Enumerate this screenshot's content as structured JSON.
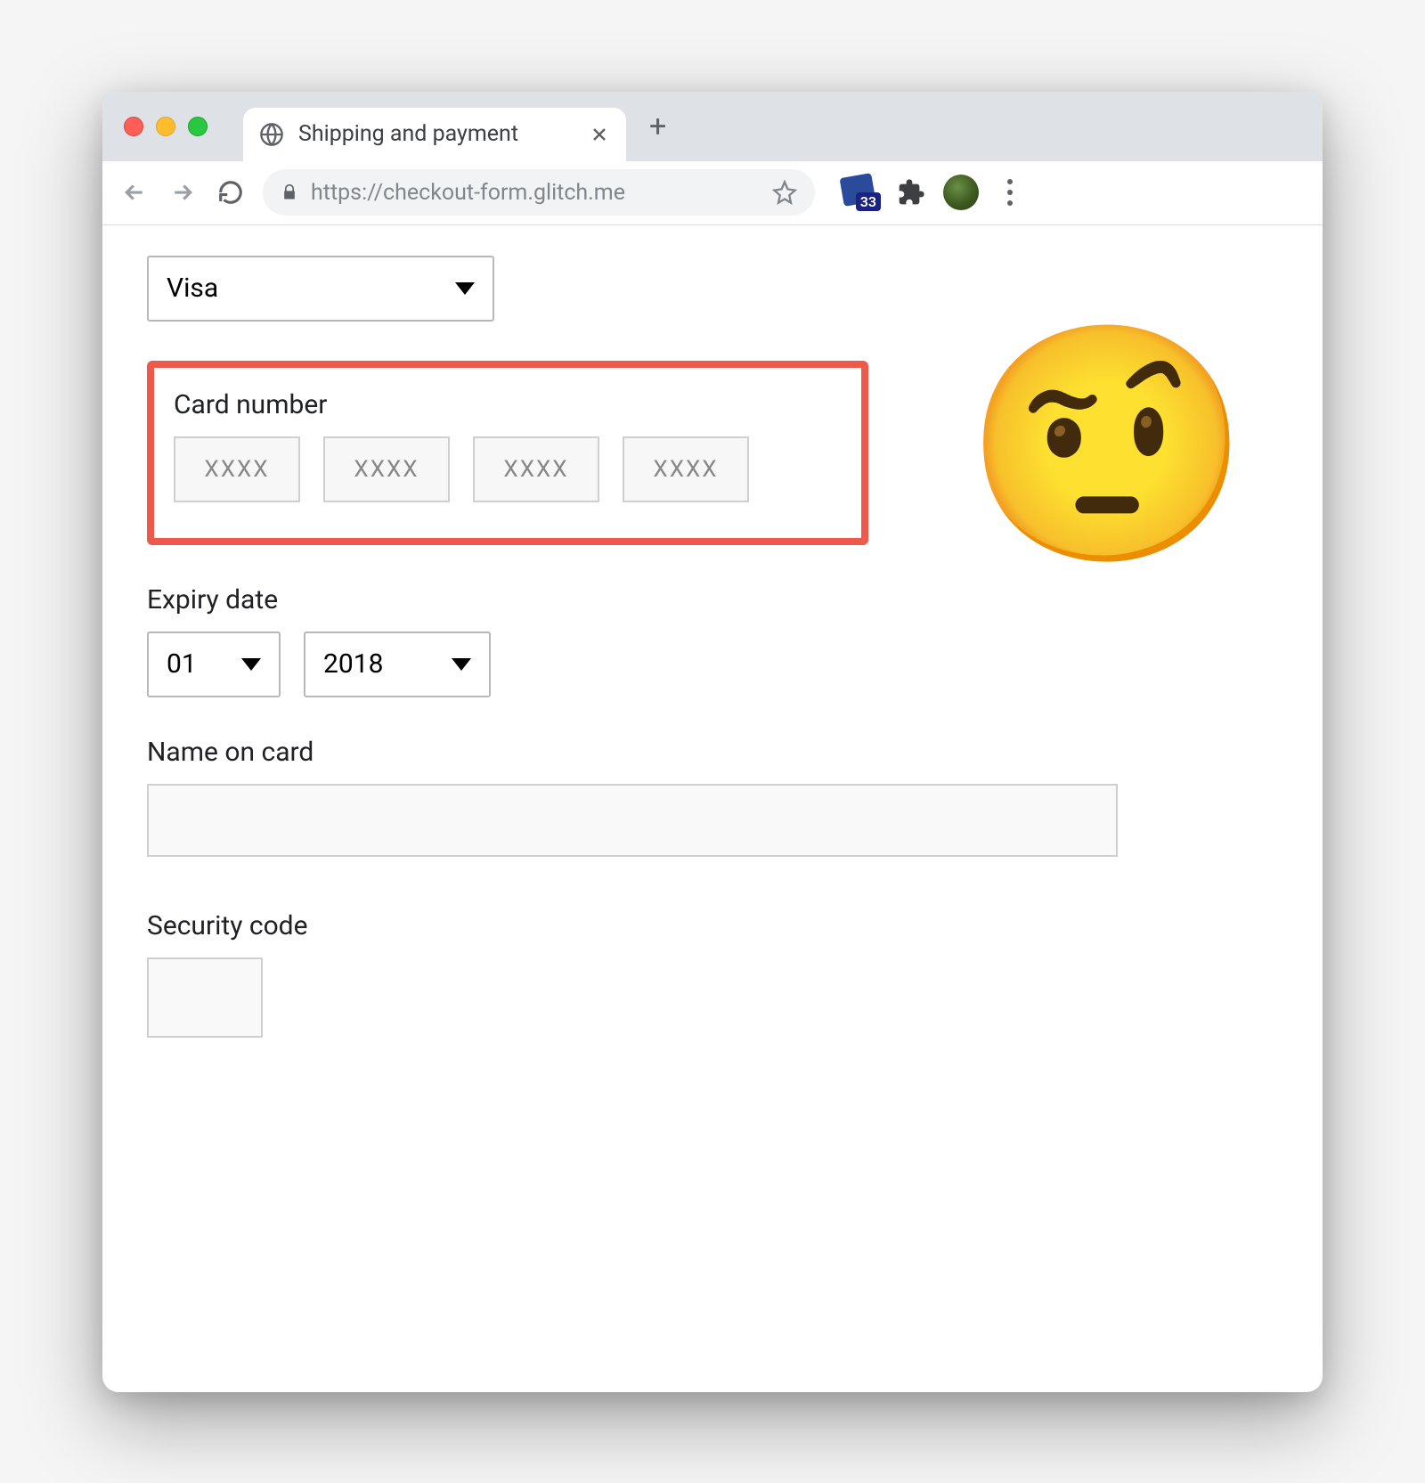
{
  "browser": {
    "tab_title": "Shipping and payment",
    "url_display": "https://checkout-form.glitch.me",
    "extension_badge_count": "33"
  },
  "form": {
    "card_type": {
      "selected": "Visa"
    },
    "card_number": {
      "label": "Card number",
      "placeholder": "XXXX"
    },
    "expiry": {
      "label": "Expiry date",
      "month": "01",
      "year": "2018"
    },
    "name_on_card": {
      "label": "Name on card",
      "value": ""
    },
    "security_code": {
      "label": "Security code",
      "value": ""
    }
  },
  "annotation": {
    "emoji": "🤨"
  }
}
